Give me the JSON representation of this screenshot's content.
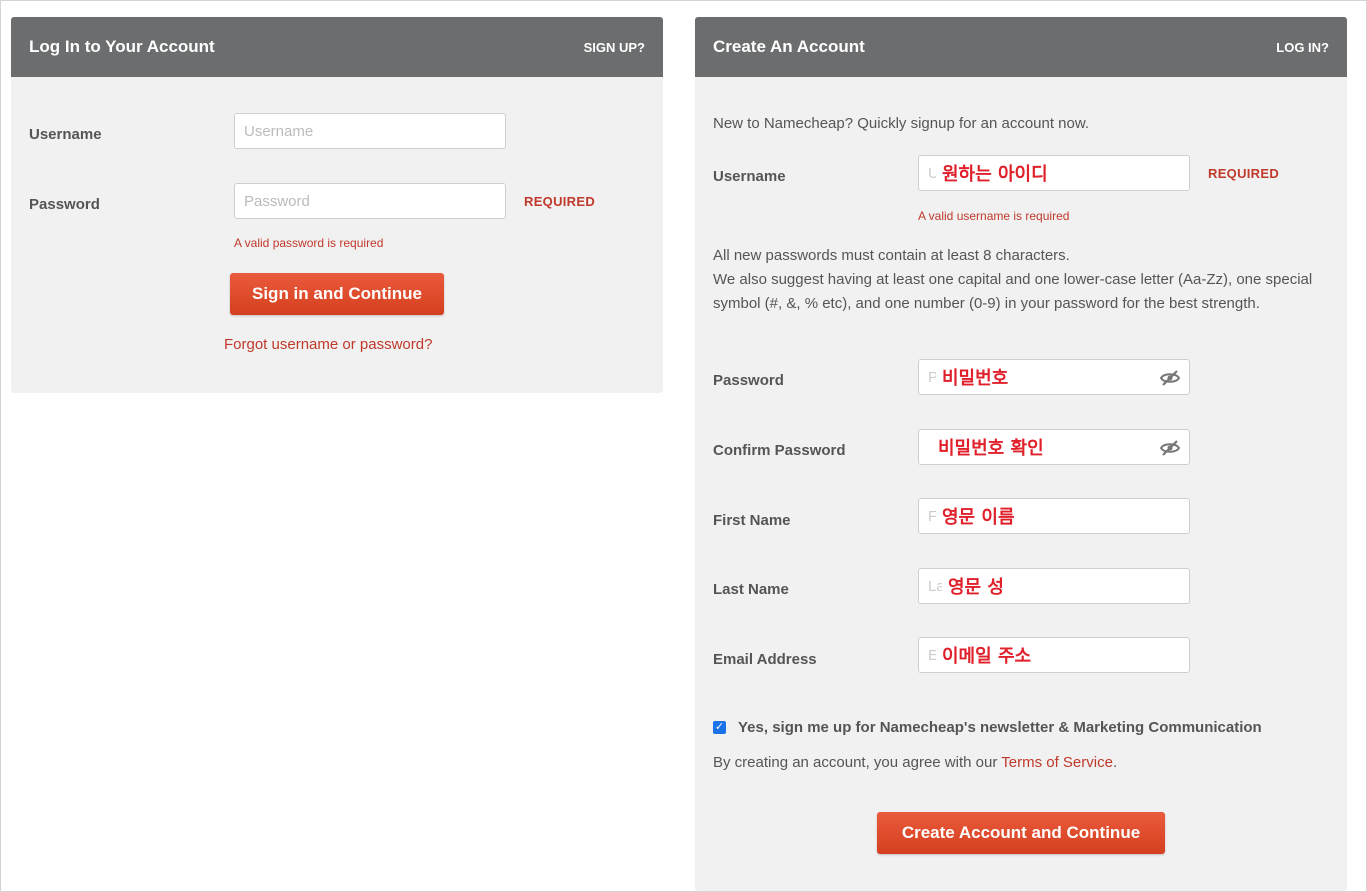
{
  "login": {
    "title": "Log In to Your Account",
    "signup_link": "SIGN UP?",
    "username_label": "Username",
    "username_placeholder": "Username",
    "password_label": "Password",
    "password_placeholder": "Password",
    "password_required": "REQUIRED",
    "password_error": "A valid password is required",
    "submit_label": "Sign in and Continue",
    "forgot_link": "Forgot username or password?"
  },
  "signup": {
    "title": "Create An Account",
    "login_link": "LOG IN?",
    "intro": "New to Namecheap? Quickly signup for an account now.",
    "username_label": "Username",
    "username_placeholder_fragment": "U",
    "username_annotation": "원하는 아이디",
    "username_required": "REQUIRED",
    "username_error": "A valid username is required",
    "password_rules_line1": "All new passwords must contain at least 8 characters.",
    "password_rules_line2": "We also suggest having at least one capital and one lower-case letter (Aa-Zz), one special symbol (#, &, % etc), and one number (0-9) in your password for the best strength.",
    "password_label": "Password",
    "password_placeholder_fragment": "P",
    "password_annotation": "비밀번호",
    "confirm_label": "Confirm Password",
    "confirm_annotation": "비밀번호 확인",
    "first_name_label": "First Name",
    "first_name_placeholder_fragment": "F",
    "first_name_annotation": "영문 이름",
    "last_name_label": "Last Name",
    "last_name_placeholder_fragment": "La",
    "last_name_annotation": "영문 성",
    "email_label": "Email Address",
    "email_placeholder_fragment": "E",
    "email_annotation": "이메일 주소",
    "newsletter_checked": true,
    "newsletter_label": "Yes, sign me up for Namecheap's newsletter & Marketing Communication",
    "terms_prefix": "By creating an account, you agree with our ",
    "terms_link": "Terms of Service",
    "terms_suffix": ".",
    "submit_label": "Create Account and Continue"
  },
  "colors": {
    "header": "#6c6d6e",
    "panel": "#f1f1f1",
    "accent": "#d4401f",
    "error": "#c0392b",
    "annotation": "#e0202a"
  },
  "icons": {
    "password_toggle": "eye-slash-icon",
    "confirm_toggle": "eye-slash-icon",
    "newsletter_checkbox": "checkmark-icon"
  }
}
